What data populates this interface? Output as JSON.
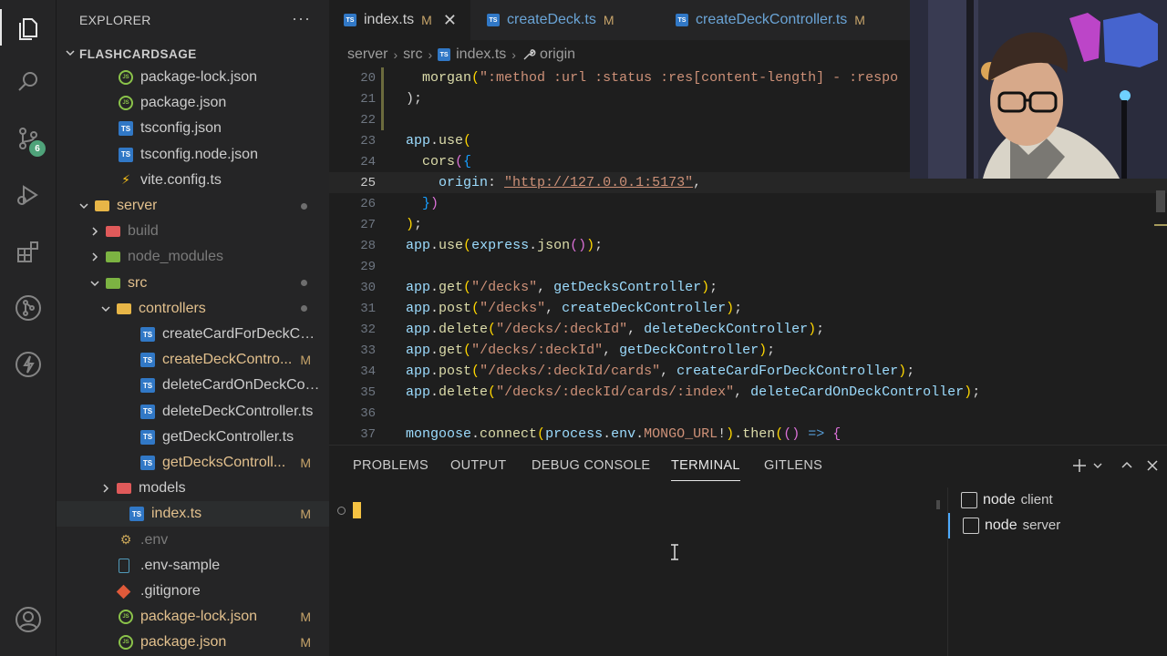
{
  "activity_bar": {
    "items": [
      {
        "icon": "files-icon"
      },
      {
        "icon": "search-icon"
      },
      {
        "icon": "source-control-icon",
        "badge": "6"
      },
      {
        "icon": "run-debug-icon"
      },
      {
        "icon": "extensions-icon"
      },
      {
        "icon": "git-graph-icon"
      },
      {
        "icon": "lightning-icon"
      },
      {
        "icon": "account-icon"
      }
    ]
  },
  "sidebar": {
    "title": "EXPLORER",
    "more": "···",
    "section": "FLASHCARDSAGE",
    "rows": [
      {
        "label": "package-lock.json",
        "icon": "json",
        "indent": 1,
        "mark": ""
      },
      {
        "label": "package.json",
        "icon": "json",
        "indent": 1,
        "mark": ""
      },
      {
        "label": "tsconfig.json",
        "icon": "ts-config",
        "indent": 1,
        "mark": ""
      },
      {
        "label": "tsconfig.node.json",
        "icon": "ts-config",
        "indent": 1,
        "mark": ""
      },
      {
        "label": "vite.config.ts",
        "icon": "vite",
        "indent": 1,
        "mark": ""
      },
      {
        "label": "server",
        "icon": "folder-yellow",
        "indent": 0,
        "arrow": "open",
        "dot": true
      },
      {
        "label": "build",
        "icon": "folder-red",
        "indent": 1,
        "arrow": "closed",
        "dim": true
      },
      {
        "label": "node_modules",
        "icon": "folder-green",
        "indent": 1,
        "arrow": "closed",
        "dim": true
      },
      {
        "label": "src",
        "icon": "folder-green",
        "indent": 1,
        "arrow": "open",
        "dot": true
      },
      {
        "label": "controllers",
        "icon": "folder-yellow",
        "indent": 2,
        "arrow": "open",
        "dot": true
      },
      {
        "label": "createCardForDeckCon...",
        "icon": "ts",
        "indent": 3,
        "mark": ""
      },
      {
        "label": "createDeckContro...",
        "icon": "ts",
        "indent": 3,
        "mark": "M"
      },
      {
        "label": "deleteCardOnDeckCon...",
        "icon": "ts",
        "indent": 3,
        "mark": ""
      },
      {
        "label": "deleteDeckController.ts",
        "icon": "ts",
        "indent": 3,
        "mark": ""
      },
      {
        "label": "getDeckController.ts",
        "icon": "ts",
        "indent": 3,
        "mark": ""
      },
      {
        "label": "getDecksControll...",
        "icon": "ts",
        "indent": 3,
        "mark": "M"
      },
      {
        "label": "models",
        "icon": "folder-red",
        "indent": 2,
        "arrow": "closed"
      },
      {
        "label": "index.ts",
        "icon": "ts",
        "indent": 2,
        "mark": "M",
        "selected": true
      },
      {
        "label": ".env",
        "icon": "env",
        "indent": 1,
        "mark": "",
        "dim": true
      },
      {
        "label": ".env-sample",
        "icon": "file",
        "indent": 1,
        "mark": ""
      },
      {
        "label": ".gitignore",
        "icon": "git",
        "indent": 1,
        "mark": ""
      },
      {
        "label": "package-lock.json",
        "icon": "json",
        "indent": 1,
        "mark": "M"
      },
      {
        "label": "package.json",
        "icon": "json",
        "indent": 1,
        "mark": "M"
      }
    ]
  },
  "editor": {
    "tabs": [
      {
        "label": "index.ts",
        "mark": "M",
        "active": true,
        "close": "✕"
      },
      {
        "label": "createDeck.ts",
        "mark": "M",
        "active": false
      },
      {
        "label": "createDeckController.ts",
        "mark": "M",
        "active": false
      }
    ],
    "breadcrumb": [
      "server",
      "src",
      "index.ts",
      "origin"
    ],
    "lines": [
      {
        "n": "20",
        "tokens": [
          [
            "  ",
            "pun"
          ],
          [
            "morgan",
            "fn"
          ],
          [
            "(",
            "br1"
          ],
          [
            "\":method :url :status :res[content-length] - :respo",
            "str"
          ]
        ],
        "mod": true
      },
      {
        "n": "21",
        "tokens": [
          [
            ");",
            "pun"
          ]
        ],
        "mod": true
      },
      {
        "n": "22",
        "tokens": [],
        "mod": true
      },
      {
        "n": "23",
        "tokens": [
          [
            "app",
            "var"
          ],
          [
            ".",
            "pun"
          ],
          [
            "use",
            "fn"
          ],
          [
            "(",
            "br1"
          ]
        ]
      },
      {
        "n": "24",
        "tokens": [
          [
            "  ",
            "pun"
          ],
          [
            "cors",
            "fn"
          ],
          [
            "(",
            "br2"
          ],
          [
            "{",
            "br3"
          ]
        ]
      },
      {
        "n": "25",
        "tokens": [
          [
            "    ",
            "pun"
          ],
          [
            "origin",
            "var"
          ],
          [
            ": ",
            "pun"
          ],
          [
            "\"http://127.0.0.1:5173\"",
            "str"
          ],
          [
            ",",
            "pun"
          ]
        ],
        "current": true
      },
      {
        "n": "26",
        "tokens": [
          [
            "  ",
            "pun"
          ],
          [
            "}",
            "br3"
          ],
          [
            ")",
            "br2"
          ]
        ]
      },
      {
        "n": "27",
        "tokens": [
          [
            ")",
            "br1"
          ],
          [
            ";",
            "pun"
          ]
        ]
      },
      {
        "n": "28",
        "tokens": [
          [
            "app",
            "var"
          ],
          [
            ".",
            "pun"
          ],
          [
            "use",
            "fn"
          ],
          [
            "(",
            "br1"
          ],
          [
            "express",
            "var"
          ],
          [
            ".",
            "pun"
          ],
          [
            "json",
            "fn"
          ],
          [
            "()",
            "br2"
          ],
          [
            ")",
            "br1"
          ],
          [
            ";",
            "pun"
          ]
        ]
      },
      {
        "n": "29",
        "tokens": []
      },
      {
        "n": "30",
        "tokens": [
          [
            "app",
            "var"
          ],
          [
            ".",
            "pun"
          ],
          [
            "get",
            "fn"
          ],
          [
            "(",
            "br1"
          ],
          [
            "\"/decks\"",
            "str"
          ],
          [
            ", ",
            "pun"
          ],
          [
            "getDecksController",
            "var"
          ],
          [
            ")",
            "br1"
          ],
          [
            ";",
            "pun"
          ]
        ]
      },
      {
        "n": "31",
        "tokens": [
          [
            "app",
            "var"
          ],
          [
            ".",
            "pun"
          ],
          [
            "post",
            "fn"
          ],
          [
            "(",
            "br1"
          ],
          [
            "\"/decks\"",
            "str"
          ],
          [
            ", ",
            "pun"
          ],
          [
            "createDeckController",
            "var"
          ],
          [
            ")",
            "br1"
          ],
          [
            ";",
            "pun"
          ]
        ]
      },
      {
        "n": "32",
        "tokens": [
          [
            "app",
            "var"
          ],
          [
            ".",
            "pun"
          ],
          [
            "delete",
            "fn"
          ],
          [
            "(",
            "br1"
          ],
          [
            "\"/decks/:deckId\"",
            "str"
          ],
          [
            ", ",
            "pun"
          ],
          [
            "deleteDeckController",
            "var"
          ],
          [
            ")",
            "br1"
          ],
          [
            ";",
            "pun"
          ]
        ]
      },
      {
        "n": "33",
        "tokens": [
          [
            "app",
            "var"
          ],
          [
            ".",
            "pun"
          ],
          [
            "get",
            "fn"
          ],
          [
            "(",
            "br1"
          ],
          [
            "\"/decks/:deckId\"",
            "str"
          ],
          [
            ", ",
            "pun"
          ],
          [
            "getDeckController",
            "var"
          ],
          [
            ")",
            "br1"
          ],
          [
            ";",
            "pun"
          ]
        ]
      },
      {
        "n": "34",
        "tokens": [
          [
            "app",
            "var"
          ],
          [
            ".",
            "pun"
          ],
          [
            "post",
            "fn"
          ],
          [
            "(",
            "br1"
          ],
          [
            "\"/decks/:deckId/cards\"",
            "str"
          ],
          [
            ", ",
            "pun"
          ],
          [
            "createCardForDeckController",
            "var"
          ],
          [
            ")",
            "br1"
          ],
          [
            ";",
            "pun"
          ]
        ]
      },
      {
        "n": "35",
        "tokens": [
          [
            "app",
            "var"
          ],
          [
            ".",
            "pun"
          ],
          [
            "delete",
            "fn"
          ],
          [
            "(",
            "br1"
          ],
          [
            "\"/decks/:deckId/cards/:index\"",
            "str"
          ],
          [
            ", ",
            "pun"
          ],
          [
            "deleteCardOnDeckController",
            "var"
          ],
          [
            ")",
            "br1"
          ],
          [
            ";",
            "pun"
          ]
        ]
      },
      {
        "n": "36",
        "tokens": []
      },
      {
        "n": "37",
        "tokens": [
          [
            "mongoose",
            "var"
          ],
          [
            ".",
            "pun"
          ],
          [
            "connect",
            "fn"
          ],
          [
            "(",
            "br1"
          ],
          [
            "process",
            "var"
          ],
          [
            ".",
            "pun"
          ],
          [
            "env",
            "var"
          ],
          [
            ".",
            "pun"
          ],
          [
            "MONGO_URL",
            "str"
          ],
          [
            "!",
            "pun"
          ],
          [
            ")",
            "br1"
          ],
          [
            ".",
            "pun"
          ],
          [
            "then",
            "fn"
          ],
          [
            "(",
            "br1"
          ],
          [
            "()",
            "br2"
          ],
          [
            " => ",
            "kw"
          ],
          [
            "{",
            "br2"
          ]
        ]
      }
    ]
  },
  "panel": {
    "tabs": [
      "PROBLEMS",
      "OUTPUT",
      "DEBUG CONSOLE",
      "TERMINAL",
      "GITLENS"
    ],
    "active_tab": "TERMINAL",
    "terminals": [
      {
        "name": "node",
        "sub": "client",
        "active": false
      },
      {
        "name": "node",
        "sub": "server",
        "active": true
      }
    ]
  },
  "colors": {
    "accent": "#4daafc",
    "modified": "#c7a46a",
    "badge": "#4fa37a"
  }
}
